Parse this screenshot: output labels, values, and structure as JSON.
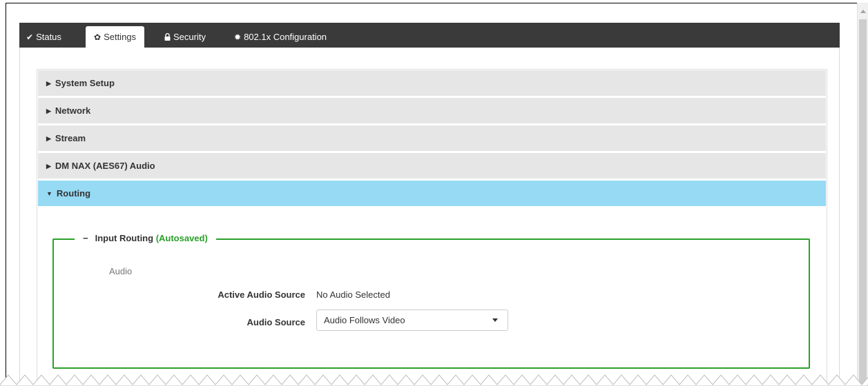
{
  "tabs": [
    {
      "label": "Status",
      "icon": "check-icon",
      "active": false
    },
    {
      "label": "Settings",
      "icon": "gear-icon",
      "active": true
    },
    {
      "label": "Security",
      "icon": "lock-icon",
      "active": false
    },
    {
      "label": "802.1x Configuration",
      "icon": "cog-icon",
      "active": false
    }
  ],
  "accordion": [
    {
      "label": "System Setup",
      "expanded": false
    },
    {
      "label": "Network",
      "expanded": false
    },
    {
      "label": "Stream",
      "expanded": false
    },
    {
      "label": "DM NAX (AES67) Audio",
      "expanded": false
    },
    {
      "label": "Routing",
      "expanded": true
    }
  ],
  "routing": {
    "group_title": "Input Routing",
    "group_status": "(Autosaved)",
    "collapse_symbol": "−",
    "section_label": "Audio",
    "active_source_label": "Active Audio Source",
    "active_source_value": "No Audio Selected",
    "audio_source_label": "Audio Source",
    "audio_source_value": "Audio Follows Video"
  },
  "colors": {
    "tabbar": "#3a3a3a",
    "accordion_open": "#96daf4",
    "accordion_closed": "#e6e6e6",
    "autosaved_green": "#2aa02a"
  }
}
